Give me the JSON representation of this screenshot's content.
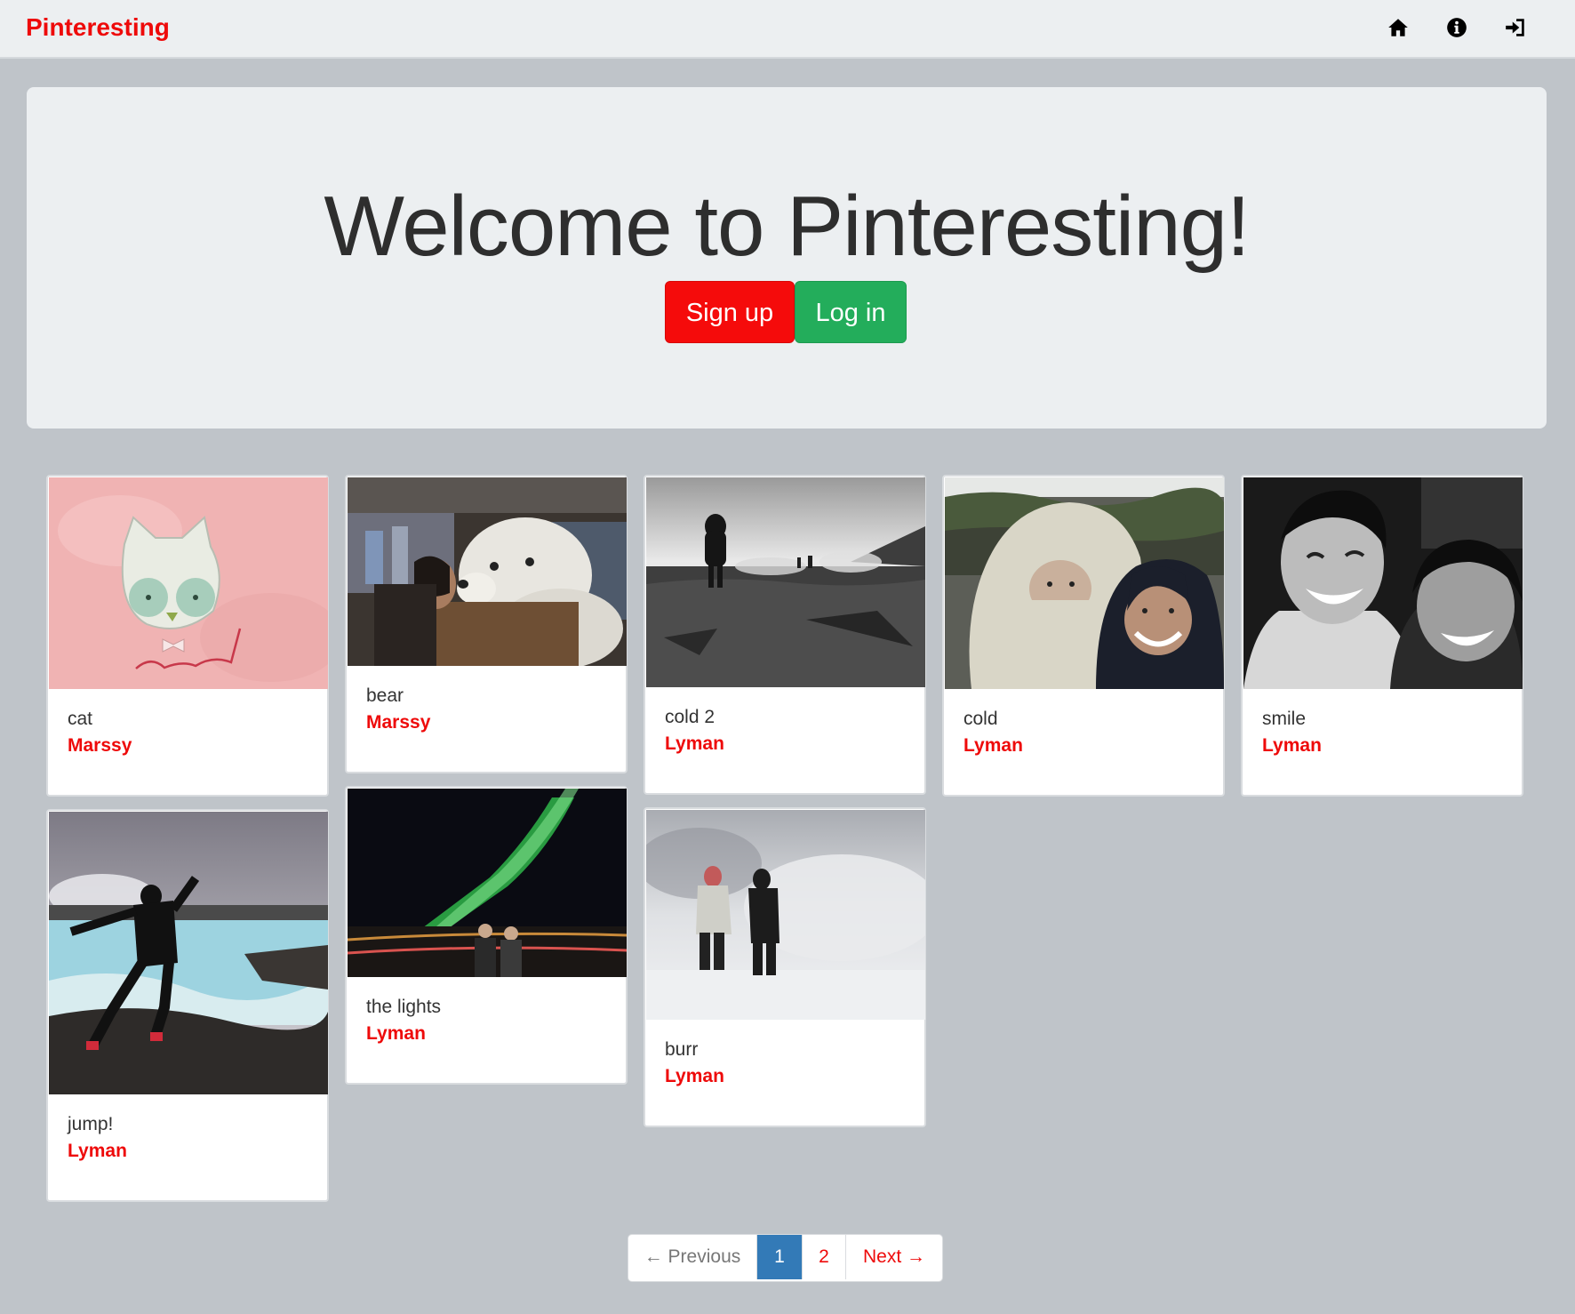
{
  "navbar": {
    "brand": "Pinteresting",
    "icons": [
      "home-icon",
      "info-icon",
      "log-in-icon"
    ]
  },
  "jumbotron": {
    "title": "Welcome to Pinteresting!",
    "signup_label": "Sign up",
    "login_label": "Log in"
  },
  "pins": [
    {
      "description": "cat",
      "author": "Marssy",
      "image": "drawing of a white cat with a bow tie on pink background, 'meow!' scribble"
    },
    {
      "description": "bear",
      "author": "Marssy",
      "image": "woman kissing a large white stuffed seal in a store"
    },
    {
      "description": "cold 2",
      "author": "Lyman",
      "image": "black and white photo of people walking on a steaming volcanic field"
    },
    {
      "description": "cold",
      "author": "Lyman",
      "image": "two people in winter hoods taking a selfie"
    },
    {
      "description": "smile",
      "author": "Lyman",
      "image": "black and white selfie of a smiling couple"
    },
    {
      "description": "jump!",
      "author": "Lyman",
      "image": "man jumping on rocks by a blue lagoon"
    },
    {
      "description": "the lights",
      "author": "Lyman",
      "image": "couple under green northern lights"
    },
    {
      "description": "burr",
      "author": "Lyman",
      "image": "two people standing in snow and fog"
    }
  ],
  "pagination": {
    "previous": "← Previous",
    "pages": [
      "1",
      "2"
    ],
    "current": "1",
    "next": "Next →"
  },
  "colors": {
    "brand": "#ee0a0a",
    "signup": "#f50b0b",
    "login": "#23ad5b",
    "active_page": "#337ab7",
    "background": "#bfc4c9"
  }
}
